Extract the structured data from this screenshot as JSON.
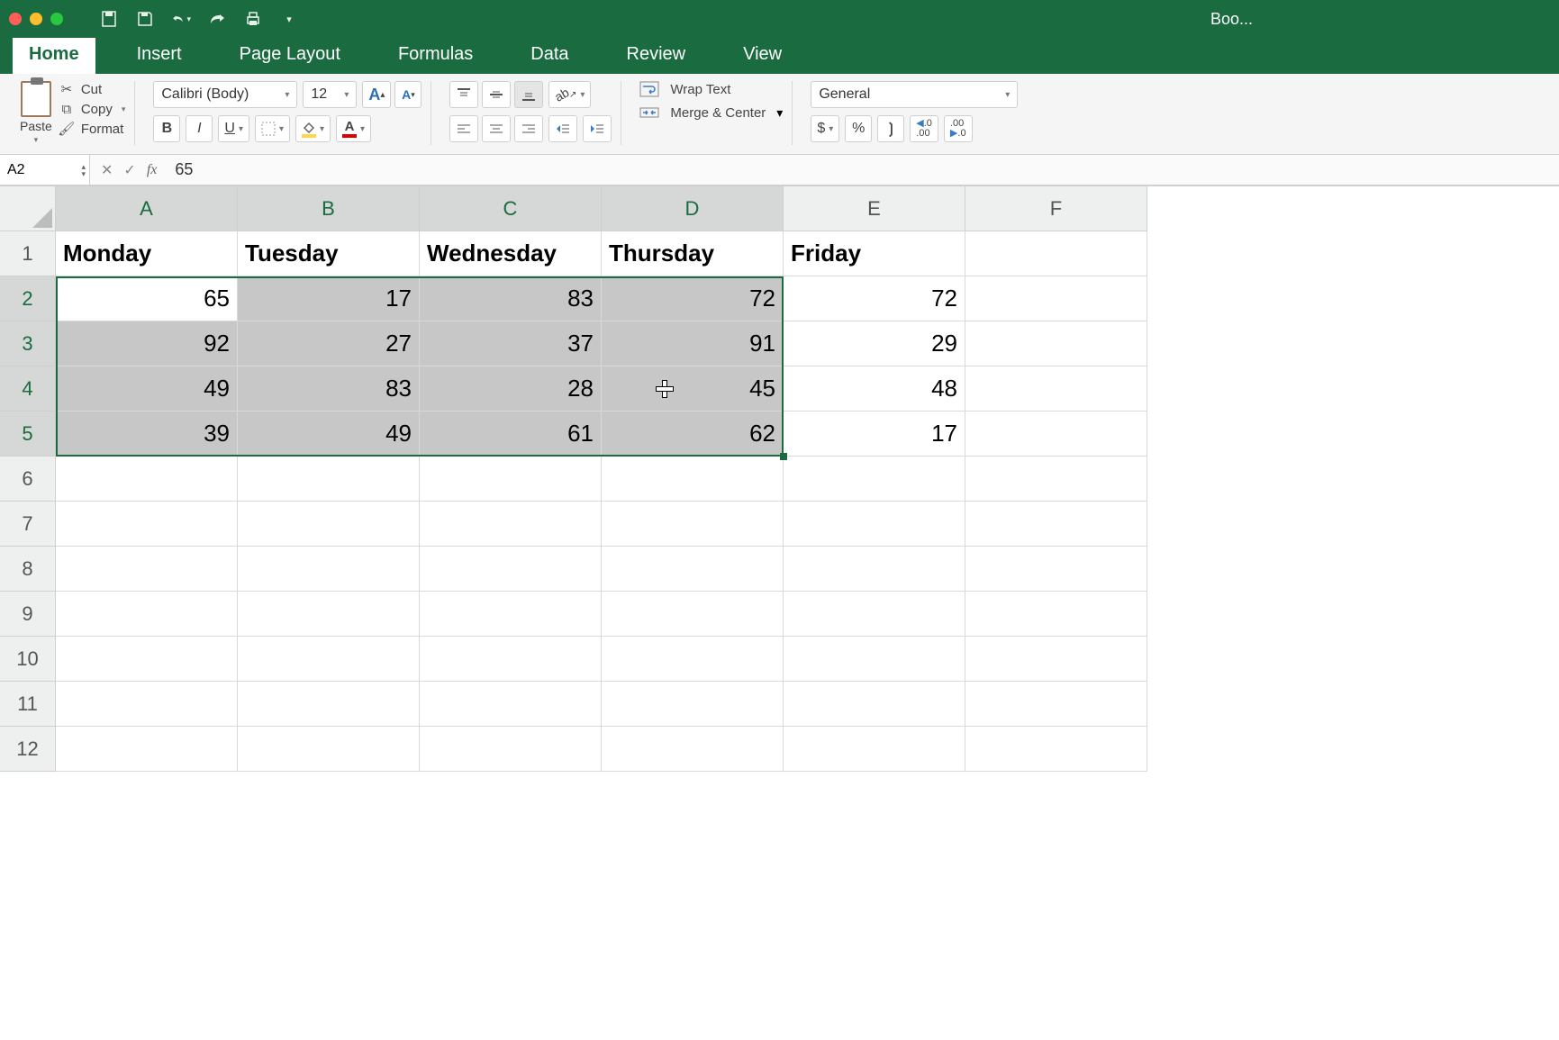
{
  "window": {
    "title": "Boo..."
  },
  "tabs": [
    "Home",
    "Insert",
    "Page Layout",
    "Formulas",
    "Data",
    "Review",
    "View"
  ],
  "active_tab": 0,
  "clipboard": {
    "paste": "Paste",
    "cut": "Cut",
    "copy": "Copy",
    "format": "Format"
  },
  "font": {
    "name": "Calibri (Body)",
    "size": "12"
  },
  "buttons": {
    "bold": "B",
    "italic": "I",
    "underline": "U",
    "wrap_text": "Wrap Text",
    "merge_center": "Merge & Center"
  },
  "number_format": {
    "selected": "General",
    "currency": "$",
    "percent": "%",
    "comma": "❳"
  },
  "namebox": "A2",
  "formula": "65",
  "columns": [
    "A",
    "B",
    "C",
    "D",
    "E",
    "F"
  ],
  "row_numbers": [
    "1",
    "2",
    "3",
    "4",
    "5",
    "6",
    "7",
    "8",
    "9",
    "10",
    "11",
    "12"
  ],
  "selected_cols": [
    "A",
    "B",
    "C",
    "D"
  ],
  "selected_rows": [
    "2",
    "3",
    "4",
    "5"
  ],
  "grid": {
    "r1": {
      "A": "Monday",
      "B": "Tuesday",
      "C": "Wednesday",
      "D": "Thursday",
      "E": "Friday",
      "F": ""
    },
    "r2": {
      "A": "65",
      "B": "17",
      "C": "83",
      "D": "72",
      "E": "72",
      "F": ""
    },
    "r3": {
      "A": "92",
      "B": "27",
      "C": "37",
      "D": "91",
      "E": "29",
      "F": ""
    },
    "r4": {
      "A": "49",
      "B": "83",
      "C": "28",
      "D": "45",
      "E": "48",
      "F": ""
    },
    "r5": {
      "A": "39",
      "B": "49",
      "C": "61",
      "D": "62",
      "E": "17",
      "F": ""
    }
  },
  "selection": {
    "start": "A2",
    "end": "D5",
    "active": "A2"
  },
  "chart_data": {
    "type": "table",
    "columns": [
      "Monday",
      "Tuesday",
      "Wednesday",
      "Thursday",
      "Friday"
    ],
    "rows": [
      [
        65,
        17,
        83,
        72,
        72
      ],
      [
        92,
        27,
        37,
        91,
        29
      ],
      [
        49,
        83,
        28,
        45,
        48
      ],
      [
        39,
        49,
        61,
        62,
        17
      ]
    ]
  }
}
